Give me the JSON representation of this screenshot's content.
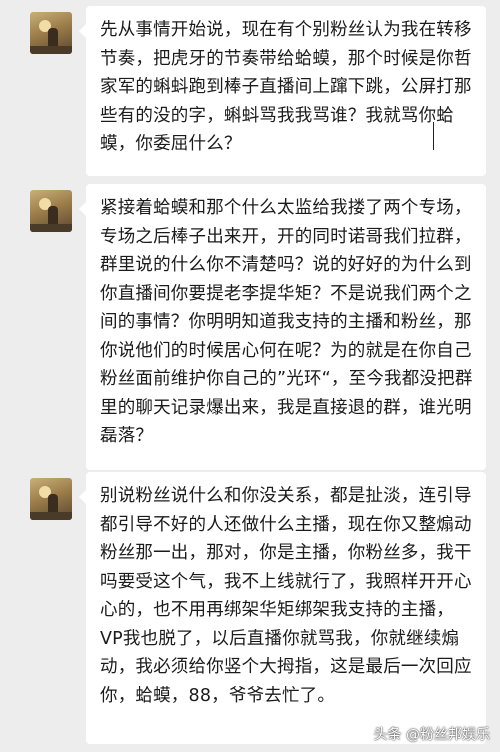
{
  "messages": [
    {
      "text": "先从事情开始说，现在有个别粉丝认为我在转移节奏，把虎牙的节奏带给蛤蟆，那个时候是你哲家军的蝌蚪跑到棒子直播间上蹿下跳，公屏打那些有的没的字，蝌蚪骂我我骂谁？我就骂你蛤蟆，你委屈什么？"
    },
    {
      "text": "紧接着蛤蟆和那个什么太监给我搂了两个专场，专场之后棒子出来开，开的同时诺哥我们拉群，群里说的什么你不清楚吗？说的好好的为什么到你直播间你要提老李提华矩？不是说我们两个之间的事情？你明明知道我支持的主播和粉丝，那你说他们的时候居心何在呢？为的就是在你自己粉丝面前维护你自己的”光环“，至今我都没把群里的聊天记录爆出来，我是直接退的群，谁光明磊落？"
    },
    {
      "text": "别说粉丝说什么和你没关系，都是扯淡，连引导都引导不好的人还做什么主播，现在你又整煽动粉丝那一出，那对，你是主播，你粉丝多，我干吗要受这个气，我不上线就行了，我照样开开心心的，也不用再绑架华矩绑架我支持的主播，VP我也脱了，以后直播你就骂我，你就继续煽动，我必须给你竖个大拇指，这是最后一次回应你，蛤蟆，88，爷爷去忙了。"
    }
  ],
  "watermark": "头条 @粉丝邦娱乐"
}
